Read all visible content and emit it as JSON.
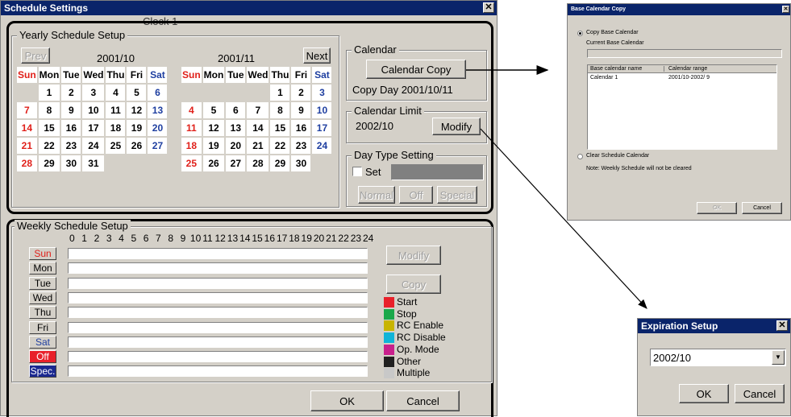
{
  "main": {
    "title": "Schedule Settings",
    "clock_label": "Clock 1",
    "yearly": {
      "title": "Yearly Schedule Setup",
      "prev": "Prev",
      "next": "Next",
      "cal1": {
        "month": "2001/10",
        "headers": [
          "Sun",
          "Mon",
          "Tue",
          "Wed",
          "Thu",
          "Fri",
          "Sat"
        ],
        "rows": [
          [
            "",
            "1",
            "2",
            "3",
            "4",
            "5",
            "6"
          ],
          [
            "7",
            "8",
            "9",
            "10",
            "11",
            "12",
            "13"
          ],
          [
            "14",
            "15",
            "16",
            "17",
            "18",
            "19",
            "20"
          ],
          [
            "21",
            "22",
            "23",
            "24",
            "25",
            "26",
            "27"
          ],
          [
            "28",
            "29",
            "30",
            "31",
            "",
            "",
            ""
          ]
        ]
      },
      "cal2": {
        "month": "2001/11",
        "headers": [
          "Sun",
          "Mon",
          "Tue",
          "Wed",
          "Thu",
          "Fri",
          "Sat"
        ],
        "rows": [
          [
            "",
            "",
            "",
            "",
            "1",
            "2",
            "3"
          ],
          [
            "4",
            "5",
            "6",
            "7",
            "8",
            "9",
            "10"
          ],
          [
            "11",
            "12",
            "13",
            "14",
            "15",
            "16",
            "17"
          ],
          [
            "18",
            "19",
            "20",
            "21",
            "22",
            "23",
            "24"
          ],
          [
            "25",
            "26",
            "27",
            "28",
            "29",
            "30",
            ""
          ]
        ]
      }
    },
    "calendar": {
      "title": "Calendar",
      "copy_btn": "Calendar Copy",
      "copy_day": "Copy Day 2001/10/11"
    },
    "limit": {
      "title": "Calendar Limit",
      "value": "2002/10",
      "modify_btn": "Modify"
    },
    "daytype": {
      "title": "Day Type Setting",
      "set_label": "Set",
      "normal": "Normal",
      "off": "Off",
      "special": "Special"
    },
    "weekly": {
      "title": "Weekly Schedule Setup",
      "hours": [
        "0",
        "1",
        "2",
        "3",
        "4",
        "5",
        "6",
        "7",
        "8",
        "9",
        "10",
        "11",
        "12",
        "13",
        "14",
        "15",
        "16",
        "17",
        "18",
        "19",
        "20",
        "21",
        "22",
        "23",
        "24"
      ],
      "days": [
        "Sun",
        "Mon",
        "Tue",
        "Wed",
        "Thu",
        "Fri",
        "Sat",
        "Off",
        "Spec."
      ],
      "modify_btn": "Modify",
      "copy_btn": "Copy",
      "legend": [
        {
          "label": "Start",
          "color": "#e8202a"
        },
        {
          "label": "Stop",
          "color": "#1aa84a"
        },
        {
          "label": "RC Enable",
          "color": "#c8b400"
        },
        {
          "label": "RC Disable",
          "color": "#10b4d8"
        },
        {
          "label": "Op. Mode",
          "color": "#c8208c"
        },
        {
          "label": "Other",
          "color": "#202020"
        },
        {
          "label": "Multiple",
          "color": "#c8c8c8"
        }
      ]
    },
    "ok": "OK",
    "cancel": "Cancel"
  },
  "base_copy": {
    "title": "Base Calendar Copy",
    "copy_option": "Copy Base Calendar",
    "current_label": "Current Base Calendar",
    "col_name": "Base calendar name",
    "col_range": "Calendar range",
    "row_name": "Calendar 1",
    "row_range": "2001/10-2002/ 9",
    "clear_option": "Clear Schedule Calendar",
    "note": "Note: Weekly Schedule will not be cleared",
    "ok": "OK",
    "cancel": "Cancel"
  },
  "expiration": {
    "title": "Expiration Setup",
    "value": "2002/10",
    "ok": "OK",
    "cancel": "Cancel"
  }
}
